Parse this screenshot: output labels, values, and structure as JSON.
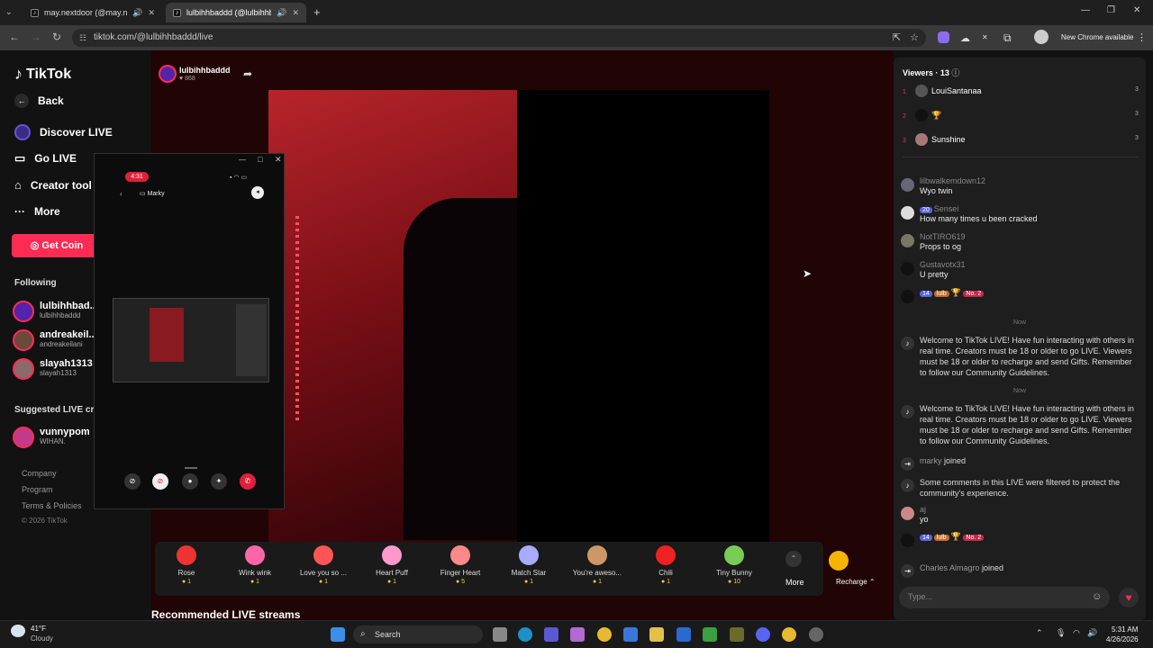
{
  "tabs": [
    {
      "title": "may.nextdoor (@may.nextdo"
    },
    {
      "title": "lulbihhbaddd (@lulbihhbad"
    }
  ],
  "url": "tiktok.com/@lulbihhbaddd/live",
  "chrome_update": "New Chrome available",
  "logo": "TikTok",
  "nav": {
    "back": "Back",
    "discover": "Discover LIVE",
    "golive": "Go LIVE",
    "creator": "Creator tool",
    "more": "More",
    "coins": "Get Coin"
  },
  "following_title": "Following",
  "following": [
    {
      "name": "lulbihhbad...",
      "handle": "lulbihhbaddd"
    },
    {
      "name": "andreakeil...",
      "handle": "andreakeilani"
    },
    {
      "name": "slayah1313",
      "handle": "slayah1313"
    }
  ],
  "suggested_title": "Suggested LIVE crea",
  "suggested": {
    "name": "vunnypom",
    "handle": "WIHAN."
  },
  "footer": {
    "company": "Company",
    "program": "Program",
    "terms": "Terms & Policies",
    "copyright": "© 2026 TikTok"
  },
  "streamer": {
    "name": "lulbihhbaddd",
    "likes": "868"
  },
  "live_badge": "LIVE",
  "call": {
    "time": "4:31",
    "contact": "Marky"
  },
  "gifts": [
    {
      "name": "Rose",
      "price": "1",
      "color": "#e33"
    },
    {
      "name": "Wink wink",
      "price": "1",
      "color": "#f6a"
    },
    {
      "name": "Love you so ...",
      "price": "1",
      "color": "#f55"
    },
    {
      "name": "Heart Puff",
      "price": "1",
      "color": "#f9c"
    },
    {
      "name": "Finger Heart",
      "price": "5",
      "color": "#f88"
    },
    {
      "name": "Match Star",
      "price": "1",
      "color": "#aaf"
    },
    {
      "name": "You're aweso...",
      "price": "1",
      "color": "#c96"
    },
    {
      "name": "Chili",
      "price": "1",
      "color": "#e22"
    },
    {
      "name": "Tiny Bunny",
      "price": "10",
      "color": "#7c5"
    }
  ],
  "gift_more": "More",
  "recharge": "Recharge",
  "recommended": "Recommended LIVE streams",
  "viewers": {
    "label": "Viewers · 13",
    "top": [
      {
        "rank": "1",
        "name": "LouiSantanaa",
        "score": "3"
      },
      {
        "rank": "2",
        "name": "",
        "score": "3"
      },
      {
        "rank": "3",
        "name": "Sunshine",
        "score": "3"
      }
    ]
  },
  "chat": [
    {
      "user": "lilbwalkemdown12",
      "text": "Wyo twin"
    },
    {
      "user": "Sensei",
      "level": "20",
      "text": "How many times u been cracked"
    },
    {
      "user": "NotTIRO619",
      "text": "Props to og"
    },
    {
      "user": "Gustavotx31",
      "text": "U pretty"
    }
  ],
  "badges": {
    "lvl": "14",
    "fan": "lulb",
    "rank": "No. 2"
  },
  "now_label": "Now",
  "welcome": "Welcome to TikTok LIVE! Have fun interacting with others in real time. Creators must be 18 or older to go LIVE. Viewers must be 18 or older to recharge and send Gifts. Remember to follow our Community Guidelines.",
  "joined1": {
    "user": "marky",
    "text": "joined"
  },
  "filtered": "Some comments in this LIVE were filtered to protect the community's experience.",
  "aj": {
    "user": "aj",
    "text": "yo"
  },
  "joined2": {
    "user": "Charles Almagro",
    "text": "joined"
  },
  "input_placeholder": "Type...",
  "taskbar": {
    "temp": "41°F",
    "weather": "Cloudy",
    "search": "Search",
    "time": "5:31 AM",
    "date": "4/26/2026"
  }
}
